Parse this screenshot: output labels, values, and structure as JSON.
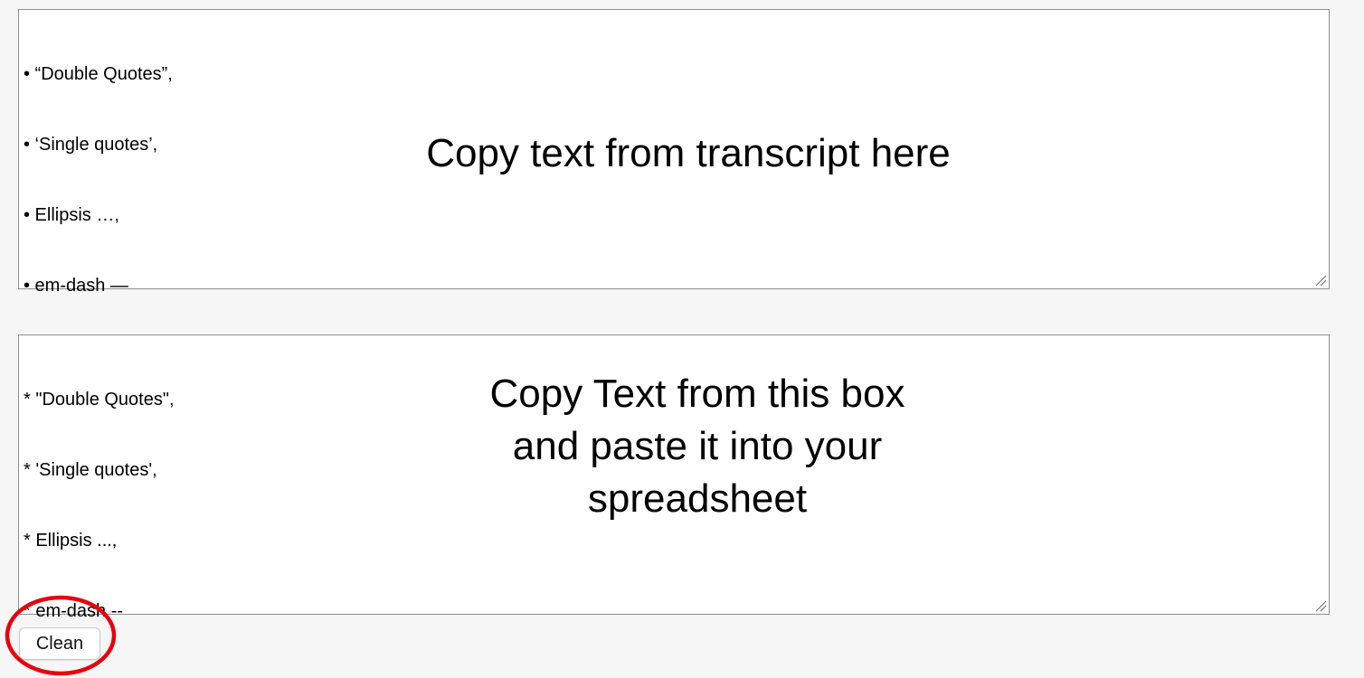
{
  "input_box": {
    "lines": [
      "• “Double Quotes”,",
      "• ‘Single quotes’,",
      "• Ellipsis …,",
      "• em-dash —"
    ],
    "overlay_text": "Copy text from transcript here"
  },
  "output_box": {
    "lines": [
      "* \"Double Quotes\",",
      "* 'Single quotes',",
      "* Ellipsis ...,",
      "* em-dash --"
    ],
    "overlay_lines": [
      "Copy Text from this box",
      "and paste it into your",
      "spreadsheet"
    ]
  },
  "clean_button": {
    "label": "Clean"
  },
  "colors": {
    "highlight": "#e8000b",
    "background": "#f6f6f6",
    "box_border": "#8e8e8e"
  }
}
